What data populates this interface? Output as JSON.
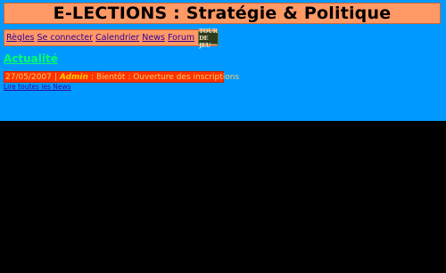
{
  "header": {
    "title": "E-LECTIONS : Stratégie & Politique"
  },
  "nav": {
    "items": [
      {
        "label": "Règles"
      },
      {
        "label": "Se connecter"
      },
      {
        "label": "Calendrier"
      },
      {
        "label": "News"
      },
      {
        "label": "Forum"
      }
    ],
    "logo_text": "TOUR DE JEU"
  },
  "news": {
    "section_title": "Actualité",
    "items": [
      {
        "date": "27/05/2007",
        "separator": "|",
        "author": "Admin",
        "colon": ":",
        "headline": "Bientôt : Ouverture des inscriptions"
      }
    ],
    "more_link": "Lire toutes les News"
  },
  "colors": {
    "page_background": "#0099ff",
    "lower_background": "#000000",
    "title_bar": "#ff9966",
    "news_bar": "#ff3300",
    "section_title": "#00ff66",
    "link": "#330099"
  }
}
